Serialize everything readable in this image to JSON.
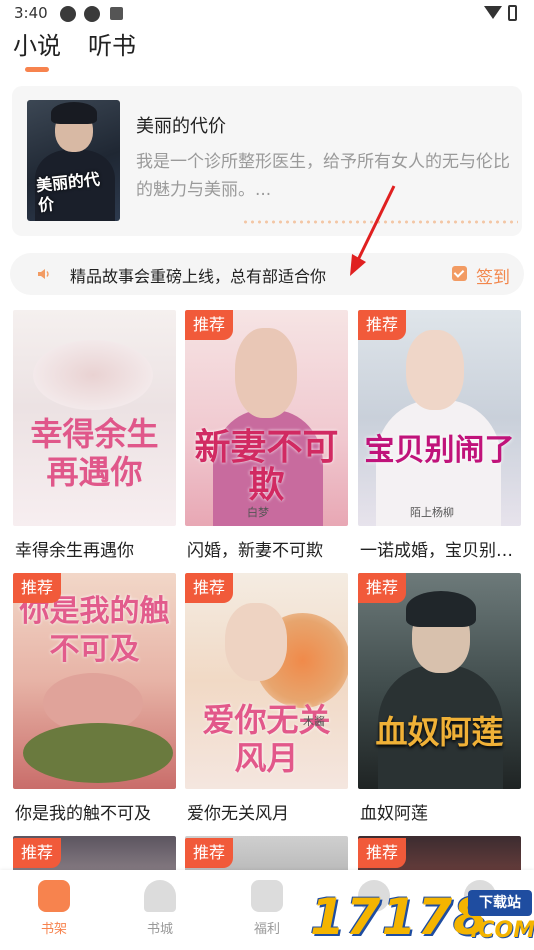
{
  "status_bar": {
    "time": "3:40"
  },
  "tabs": [
    {
      "label": "小说"
    },
    {
      "label": "听书"
    }
  ],
  "featured": {
    "title": "美丽的代价",
    "description": "我是一个诊所整形医生，给予所有女人的无与伦比的魅力与美丽。...",
    "cover_title": "美丽的代价"
  },
  "notice": {
    "text": "精品故事会重磅上线，总有部适合你",
    "signin_label": "签到"
  },
  "badge_label": "推荐",
  "books": [
    {
      "title": "幸得余生再遇你",
      "cover_text": "幸得余生再遇你",
      "badge": false
    },
    {
      "title": "闪婚，新妻不可欺",
      "cover_text": "新妻不可欺",
      "author": "白梦",
      "badge": true
    },
    {
      "title": "一诺成婚，宝贝别闹了",
      "cover_text": "宝贝别闹了",
      "author": "陌上杨柳",
      "badge": true
    },
    {
      "title": "你是我的触不可及",
      "cover_text": "你是我的触不可及",
      "badge": true
    },
    {
      "title": "爱你无关风月",
      "cover_text": "爱你无关风月",
      "author": "木酱",
      "badge": true
    },
    {
      "title": "血奴阿莲",
      "cover_text": "血奴阿莲",
      "badge": true
    }
  ],
  "bottom_nav": [
    {
      "label": "书架",
      "active": true
    },
    {
      "label": "书城",
      "active": false
    },
    {
      "label": "福利",
      "active": false
    },
    {
      "label": "",
      "active": false
    },
    {
      "label": "",
      "active": false
    }
  ],
  "watermark": {
    "number": "17178",
    "tag": "下载站",
    "domain": ".COM"
  },
  "colors": {
    "accent": "#f7834e",
    "badge": "#f15a3a",
    "annotation_arrow": "#e02020"
  }
}
